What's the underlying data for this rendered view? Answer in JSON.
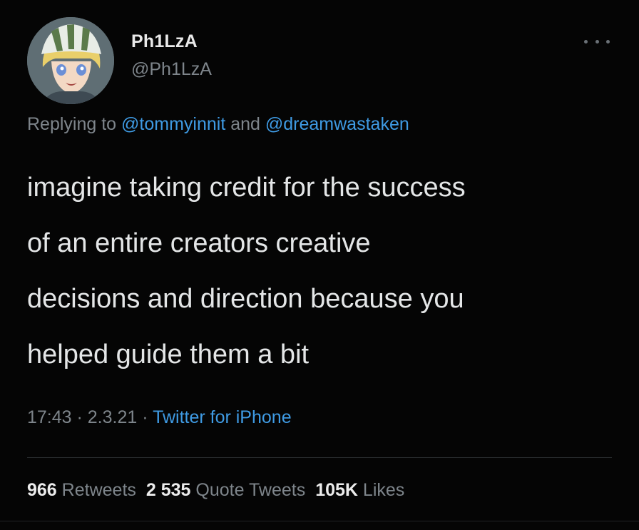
{
  "tweet": {
    "display_name": "Ph1LzA",
    "handle": "@Ph1LzA",
    "more_icon": "more-dots-icon",
    "replying_prefix": "Replying to ",
    "mention_1": "@tommyinnit",
    "mention_join": " and ",
    "mention_2": "@dreamwastaken",
    "lines": [
      "imagine taking credit for the success",
      "of an entire creators creative",
      "decisions and direction because you",
      "helped guide them a bit"
    ],
    "time": "17:43",
    "sep": " · ",
    "date": "2.3.21",
    "source": "Twitter for iPhone",
    "retweets_count": "966",
    "retweets_label": "Retweets",
    "quotes_count": "2 535",
    "quotes_label": "Quote Tweets",
    "likes_count": "105K",
    "likes_label": "Likes"
  },
  "colors": {
    "background": "#050505",
    "link": "#3f9be4",
    "muted": "#7e858b",
    "text": "#e4e6e7"
  }
}
